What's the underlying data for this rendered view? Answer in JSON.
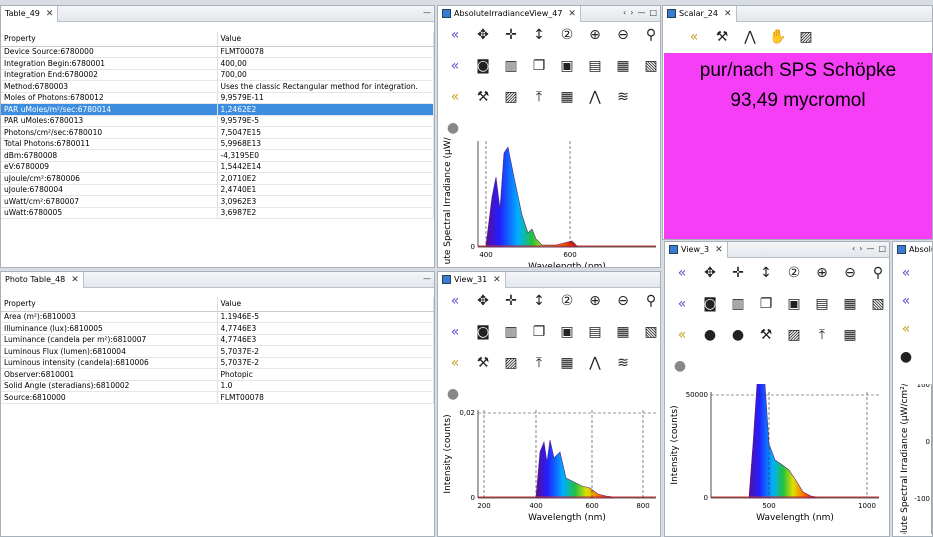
{
  "table49": {
    "tab": "Table_49",
    "headers": [
      "Property",
      "Value"
    ],
    "rows": [
      [
        "Device Source:6780000",
        "FLMT00078"
      ],
      [
        "Integration Begin:6780001",
        "400,00"
      ],
      [
        "Integration End:6780002",
        "700,00"
      ],
      [
        "Method:6780003",
        "Uses the classic Rectangular method for integration."
      ],
      [
        "Moles of Photons:6780012",
        "9,9579E-11"
      ],
      [
        "PAR uMoles/m²/sec:6780014",
        "1,2462E2"
      ],
      [
        "PAR uMoles:6780013",
        "9,9579E-5"
      ],
      [
        "Photons/cm²/sec:6780010",
        "7,5047E15"
      ],
      [
        "Total Photons:6780011",
        "5,9968E13"
      ],
      [
        "dBm:6780008",
        "-4,3195E0"
      ],
      [
        "eV:6780009",
        "1,5442E14"
      ],
      [
        "uJoule/cm²:6780006",
        "2,0710E2"
      ],
      [
        "uJoule:6780004",
        "2,4740E1"
      ],
      [
        "uWatt/cm²:6780007",
        "3,0962E3"
      ],
      [
        "uWatt:6780005",
        "3,6987E2"
      ]
    ],
    "selected_row": 5
  },
  "table48": {
    "tab": "Photo Table_48",
    "headers": [
      "Property",
      "Value"
    ],
    "rows": [
      [
        "Area (m²):6810003",
        "1.1946E-5"
      ],
      [
        "Illuminance (lux):6810005",
        "4,7746E3"
      ],
      [
        "Luminance (candela per m²):6810007",
        "4,7746E3"
      ],
      [
        "Luminous Flux (lumen):6810004",
        "5,7037E-2"
      ],
      [
        "Luminous intensity (candela):6810006",
        "5,7037E-2"
      ],
      [
        "Observer:6810001",
        "Photopic"
      ],
      [
        "Solid Angle (steradians):6810002",
        "1.0"
      ],
      [
        "Source:6810000",
        "FLMT00078"
      ]
    ]
  },
  "irr47": {
    "tab": "AbsoluteIrradianceView_47"
  },
  "scalar24": {
    "tab": "Scalar_24",
    "line1": "pur/nach SPS Schöpke",
    "line2": "93,49  mycromol"
  },
  "view31": {
    "tab": "View_31"
  },
  "view3": {
    "tab": "View_3"
  },
  "absolu": {
    "tab": "Absolu"
  },
  "chart_data": [
    {
      "type": "area",
      "ylabel": "ute Spectral Irradiance (µW/cm",
      "xlabel": "Wavelength (nm)",
      "x_ticks": [
        "400",
        "600"
      ],
      "y_ticks": [
        "0"
      ]
    },
    {
      "type": "area",
      "ylabel": "Intensity (counts)",
      "xlabel": "Wavelength (nm)",
      "x_ticks": [
        "200",
        "400",
        "600",
        "800"
      ],
      "y_ticks": [
        "0",
        "0,02"
      ],
      "xlim": [
        180,
        820
      ]
    },
    {
      "type": "area",
      "ylabel": "Intensity (counts)",
      "xlabel": "Wavelength (nm)",
      "x_ticks": [
        "500",
        "1000"
      ],
      "y_ticks": [
        "0",
        "50000"
      ]
    },
    {
      "type": "area",
      "ylabel": "olute Spectral Irradiance (µW/cm²/r",
      "y_ticks": [
        "100",
        "0",
        "-100"
      ]
    }
  ],
  "icons": {
    "row1": [
      "rewind-icon",
      "pan-icon",
      "move-horizontal-icon",
      "move-vertical-icon",
      "zoom-2-icon",
      "zoom-in-icon",
      "zoom-out-icon",
      "search-icon"
    ],
    "row2": [
      "back-icon",
      "camera-icon",
      "trash-icon",
      "copy-icon",
      "save-icon",
      "save-all-icon",
      "export-icon",
      "print-icon"
    ],
    "row3": [
      "back-orange-icon",
      "tools-icon",
      "image-icon",
      "peak-arrow-icon",
      "table-icon",
      "spectrum-icon",
      "noise-icon"
    ]
  }
}
